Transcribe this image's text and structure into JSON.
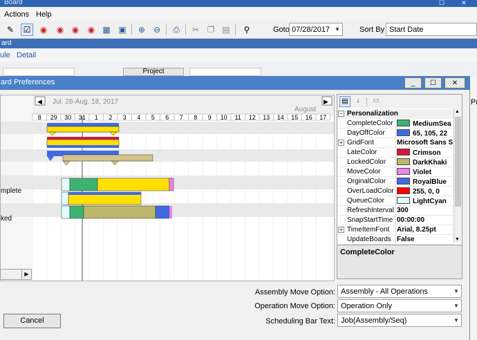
{
  "back_window": {
    "title": "Board",
    "menu": [
      "Actions",
      "Help"
    ],
    "goto_label": "Goto",
    "goto_value": "07/28/2017",
    "sortby_label": "Sort By",
    "sortby_value": "Start Date",
    "blue_bar_text": "ard",
    "subnav": [
      "ule",
      "Detail"
    ],
    "project_button": "Project",
    "right_edge_text": "Pr"
  },
  "dialog": {
    "title": "ard Preferences",
    "min_glyph": "_",
    "max_glyph": "☐",
    "close_glyph": "✕",
    "chart": {
      "range_label": "Jul. 28-Aug. 18, 2017",
      "month_label": "August",
      "days": [
        "8",
        "29",
        "30",
        "31",
        "1",
        "2",
        "3",
        "4",
        "5",
        "6",
        "7",
        "8",
        "9",
        "10",
        "11",
        "12",
        "13",
        "14",
        "15",
        "16",
        "17"
      ],
      "row_labels": [
        "mplete",
        "ked"
      ],
      "nav_left": "◀",
      "nav_right": "▶"
    },
    "properties": {
      "category": "Personalization",
      "rows": [
        {
          "name": "CompleteColor",
          "value": "MediumSea",
          "color": "#3cb371"
        },
        {
          "name": "DayOffColor",
          "value": "65, 105, 22",
          "color": "#4169e1"
        },
        {
          "name": "GridFont",
          "value": "Microsoft Sans S",
          "expand": true
        },
        {
          "name": "LateColor",
          "value": "Crimson",
          "color": "#dc143c"
        },
        {
          "name": "LockedColor",
          "value": "DarkKhaki",
          "color": "#bdb76b"
        },
        {
          "name": "MoveColor",
          "value": "Violet",
          "color": "#ee82ee"
        },
        {
          "name": "OrginalColor",
          "value": "RoyalBlue",
          "color": "#4169e1"
        },
        {
          "name": "OverLoadColor",
          "value": "255, 0, 0",
          "color": "#ff0000"
        },
        {
          "name": "QueueColor",
          "value": "LightCyan",
          "color": "#e0ffff"
        },
        {
          "name": "RefreshInterval",
          "value": "300"
        },
        {
          "name": "SnapStartTime",
          "value": "00:00:00"
        },
        {
          "name": "TimeItemFont",
          "value": "Arial, 8.25pt",
          "expand": true
        },
        {
          "name": "UpdateBoards",
          "value": "False"
        }
      ],
      "description_title": "CompleteColor"
    },
    "options": {
      "assembly_move_label": "Assembly Move Option:",
      "assembly_move_value": "Assembly - All Operations",
      "operation_move_label": "Operation Move Option:",
      "operation_move_value": "Operation Only",
      "scheduling_bar_label": "Scheduling Bar Text:",
      "scheduling_bar_value": "Job(Assembly/Seq)"
    },
    "cancel_label": "Cancel"
  }
}
